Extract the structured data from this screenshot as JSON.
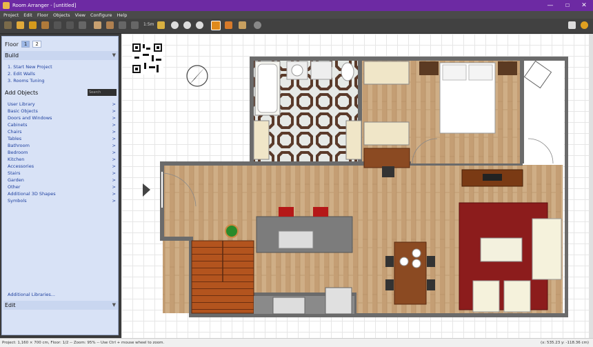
{
  "window": {
    "title": "Room Arranger - [untitled]",
    "minimize": "—",
    "maximize": "☐",
    "close": "✕"
  },
  "menu": [
    "Project",
    "Edit",
    "Floor",
    "Objects",
    "View",
    "Configure",
    "Help"
  ],
  "toolbar": {
    "zoom_readout": "1:5m",
    "accent": "#e08a1c"
  },
  "floor": {
    "label": "Floor",
    "tabs": [
      "1",
      "2"
    ]
  },
  "build": {
    "title": "Build",
    "steps": [
      "1. Start New Project",
      "2. Edit Walls",
      "3. Rooms Tuning"
    ]
  },
  "add_objects": {
    "title": "Add Objects",
    "search_placeholder": "Search",
    "items": [
      "User Library",
      "Basic Objects",
      "Doors and Windows",
      "Cabinets",
      "Chairs",
      "Tables",
      "Bathroom",
      "Bedroom",
      "Kitchen",
      "Accessories",
      "Stairs",
      "Garden",
      "Other",
      "Additional 3D Shapes",
      "Symbols"
    ],
    "arrow": ">",
    "more": "Additional Libraries..."
  },
  "edit": {
    "title": "Edit"
  },
  "status": {
    "left": "Project: 1,160 × 700 cm, Floor: 1/2 -- Zoom: 95% -- Use Ctrl + mouse wheel to zoom.",
    "right": "(x: 535.23 y: -118.36 cm)"
  },
  "colors": {
    "title_bar": "#6d2aa3",
    "panel": "#d8e2f6",
    "link": "#1d3f9e",
    "wood": "#c9a57a",
    "wall": "#6b6b6b",
    "rug": "#8c1c1c"
  }
}
